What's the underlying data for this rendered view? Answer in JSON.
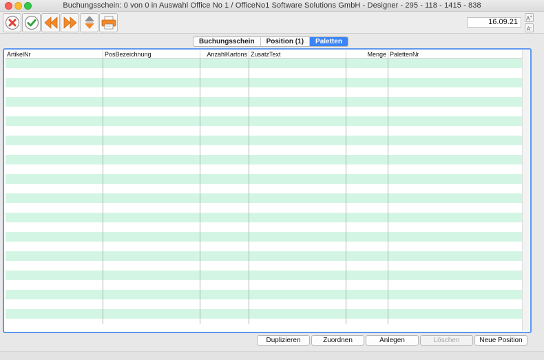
{
  "window": {
    "title": "Buchungsschein: 0 von 0 in Auswahl Office No 1 /  OfficeNo1 Software Solutions GmbH - Designer - 295 - 118 - 1415 - 838"
  },
  "toolbar": {
    "icons": [
      "cancel-icon",
      "confirm-check-icon",
      "previous-arrow-icon",
      "next-arrow-icon",
      "sort-updown-icon",
      "print-icon"
    ],
    "date": "16.09.21",
    "font_larger": "A",
    "font_smaller": "A"
  },
  "tabs": [
    {
      "label": "Buchungsschein",
      "active": false
    },
    {
      "label": "Position (1)",
      "active": false
    },
    {
      "label": "Paletten",
      "active": true
    }
  ],
  "grid": {
    "columns": [
      "ArtikelNr",
      "PosBezeichnung",
      "AnzahlKartons",
      "ZusatzText",
      "Menge",
      "PalettenNr"
    ],
    "row_count": 28,
    "colors": {
      "stripe": "#d3f6e4",
      "selection_border": "#5e97ef"
    }
  },
  "buttons": {
    "duplicate": "Duplizieren",
    "assign": "Zuordnen",
    "create": "Anlegen",
    "delete": "Löschen",
    "new_position": "Neue Position"
  }
}
